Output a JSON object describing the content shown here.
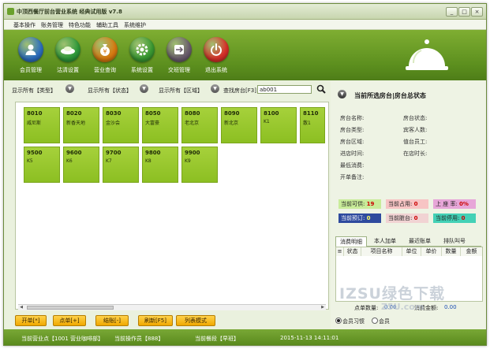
{
  "window": {
    "title": "中顶西餐厅前台营业系统 经典试用版 v7.8",
    "controls": [
      "_",
      "□",
      "×"
    ]
  },
  "menu": [
    "基本操作",
    "账务管理",
    "特色功能",
    "辅助工具",
    "系统维护"
  ],
  "toolbar": {
    "buttons": [
      {
        "label": "会员管理",
        "icon": "member-icon",
        "color": "#2d6fc0"
      },
      {
        "label": "沽清设置",
        "icon": "plate-icon",
        "color": "#2f9a3a"
      },
      {
        "label": "营业查询",
        "icon": "money-bag-icon",
        "color": "#d97a10"
      },
      {
        "label": "系统设置",
        "icon": "gear-icon",
        "color": "#3a9a32"
      },
      {
        "label": "交班管理",
        "icon": "handover-icon",
        "color": "#6b5d6e"
      },
      {
        "label": "退出系统",
        "icon": "power-icon",
        "color": "#d9302a"
      }
    ]
  },
  "filters": {
    "type": "显示所有【类型】",
    "status": "显示所有【状态】",
    "area": "显示所有【区域】",
    "search_label": "查找房台[F3]",
    "search_value": "ab001"
  },
  "rooms": [
    {
      "no": "8010",
      "name": "威尼斯"
    },
    {
      "no": "8020",
      "name": "新香天地"
    },
    {
      "no": "8030",
      "name": "金沙会"
    },
    {
      "no": "8050",
      "name": "大富豪"
    },
    {
      "no": "8080",
      "name": "老北京"
    },
    {
      "no": "8090",
      "name": "新北京"
    },
    {
      "no": "8100",
      "name": "K1"
    },
    {
      "no": "8110",
      "name": "散1"
    },
    {
      "no": "9500",
      "name": "K5"
    },
    {
      "no": "9600",
      "name": "K6"
    },
    {
      "no": "9700",
      "name": "K7"
    },
    {
      "no": "9800",
      "name": "K8"
    },
    {
      "no": "9900",
      "name": "K9"
    }
  ],
  "bottom_buttons": [
    "开单[*]",
    "点单[+]",
    "结账[-]",
    "刷新[F5]",
    "列表模式"
  ],
  "right_panel": {
    "header": "当前所选房台|房台总状态",
    "info_left": [
      "房台名称:",
      "房台类型:",
      "房台区域:",
      "进店时间:",
      "最低消费:",
      "开单备注:"
    ],
    "info_right": [
      "房台状态:",
      "宾客人数:",
      "值台员工:",
      "在店时长:"
    ],
    "stats": [
      {
        "label": "当前可供:",
        "value": "19",
        "bg": "#c9ec9a"
      },
      {
        "label": "当前占用:",
        "value": "0",
        "bg": "#f7c4c4"
      },
      {
        "label": "上 座 率:",
        "value": "0%",
        "bg": "#e7a6d8"
      },
      {
        "label": "当前预订:",
        "value": "0",
        "bg": "#2e4a9e"
      },
      {
        "label": "当前脏台:",
        "value": "0",
        "bg": "#f1d3d3"
      },
      {
        "label": "当前停用:",
        "value": "0",
        "bg": "#43d1b6"
      }
    ],
    "tabs": [
      "消费明细",
      "本人加单",
      "最近账单",
      "排队叫号"
    ],
    "columns": [
      "≡",
      "状态",
      "项目名称",
      "单位",
      "单价",
      "数量",
      "金额"
    ],
    "sum_qty_label": "点单数量:",
    "sum_qty_value": "0.00",
    "sum_amt_label": "消费金额:",
    "sum_amt_value": "0.00",
    "radios": [
      "会员习惯",
      "会员"
    ]
  },
  "status": {
    "outlet": "当前营业点【1001 营业咖啡部】",
    "operator": "当前操作员【888】",
    "shift": "当前餐段【早班】",
    "datetime": "2015-11-13 14:11:01"
  },
  "watermark": {
    "line1": "IZSU绿色下载",
    "line2": "Z5U.com"
  }
}
